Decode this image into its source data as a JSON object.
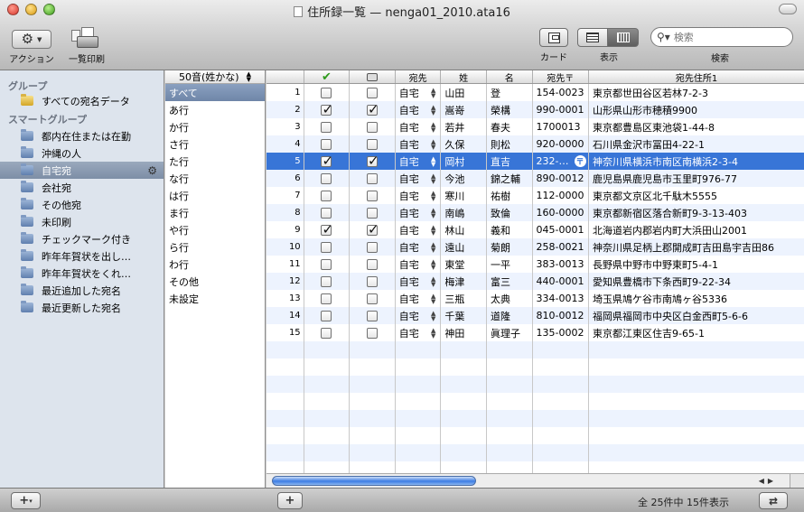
{
  "window": {
    "title": "住所録一覧 — nenga01_2010.ata16"
  },
  "toolbar": {
    "action_label": "アクション",
    "print_label": "一覧印刷",
    "card_label": "カード",
    "view_label": "表示",
    "search_label": "検索",
    "search_placeholder": "検索"
  },
  "sidebar": {
    "group_heading": "グループ",
    "all_item": "すべての宛名データ",
    "smart_heading": "スマートグループ",
    "items": [
      {
        "label": "都内在住または在勤"
      },
      {
        "label": "沖縄の人"
      },
      {
        "label": "自宅宛"
      },
      {
        "label": "会社宛"
      },
      {
        "label": "その他宛"
      },
      {
        "label": "未印刷"
      },
      {
        "label": "チェックマーク付き"
      },
      {
        "label": "昨年年賀状を出し…"
      },
      {
        "label": "昨年年賀状をくれ…"
      },
      {
        "label": "最近追加した宛名"
      },
      {
        "label": "最近更新した宛名"
      }
    ],
    "selected_index": 2
  },
  "index": {
    "sort_label": "50音(姓かな)",
    "items": [
      "すべて",
      "あ行",
      "か行",
      "さ行",
      "た行",
      "な行",
      "は行",
      "ま行",
      "や行",
      "ら行",
      "わ行",
      "その他",
      "未設定"
    ],
    "selected_index": 0
  },
  "table": {
    "headers": {
      "num": "",
      "check": "✔",
      "print": "",
      "dest": "宛先",
      "sei": "姓",
      "mei": "名",
      "zip": "宛先〒",
      "address": "宛先住所1"
    },
    "rows": [
      {
        "no": "1",
        "checked": false,
        "printed": false,
        "dest": "自宅",
        "sei": "山田",
        "mei": "登",
        "zip": "154-0023",
        "address": "東京都世田谷区若林7-2-3"
      },
      {
        "no": "2",
        "checked": true,
        "printed": true,
        "dest": "自宅",
        "sei": "嵩嵜",
        "mei": "榮構",
        "zip": "990-0001",
        "address": "山形県山形市穂積9900"
      },
      {
        "no": "3",
        "checked": false,
        "printed": false,
        "dest": "自宅",
        "sei": "若井",
        "mei": "春夫",
        "zip": "1700013",
        "address": "東京都豊島区東池袋1-44-8"
      },
      {
        "no": "4",
        "checked": false,
        "printed": false,
        "dest": "自宅",
        "sei": "久保",
        "mei": "則松",
        "zip": "920-0000",
        "address": "石川県金沢市冨田4-22-1"
      },
      {
        "no": "5",
        "checked": true,
        "printed": true,
        "dest": "自宅",
        "sei": "岡村",
        "mei": "直吉",
        "zip": "232-…",
        "address": "神奈川県横浜市南区南横浜2-3-4"
      },
      {
        "no": "6",
        "checked": false,
        "printed": false,
        "dest": "自宅",
        "sei": "今池",
        "mei": "錦之輔",
        "zip": "890-0012",
        "address": "鹿児島県鹿児島市玉里町976-77"
      },
      {
        "no": "7",
        "checked": false,
        "printed": false,
        "dest": "自宅",
        "sei": "寒川",
        "mei": "祐樹",
        "zip": "112-0000",
        "address": "東京都文京区北千駄木5555"
      },
      {
        "no": "8",
        "checked": false,
        "printed": false,
        "dest": "自宅",
        "sei": "南嶋",
        "mei": "致倫",
        "zip": "160-0000",
        "address": "東京都新宿区落合新町9-3-13-403"
      },
      {
        "no": "9",
        "checked": true,
        "printed": true,
        "dest": "自宅",
        "sei": "林山",
        "mei": "義和",
        "zip": "045-0001",
        "address": "北海道岩内郡岩内町大浜田山2001"
      },
      {
        "no": "10",
        "checked": false,
        "printed": false,
        "dest": "自宅",
        "sei": "遠山",
        "mei": "菊朗",
        "zip": "258-0021",
        "address": "神奈川県足柄上郡開成町吉田島宇吉田86"
      },
      {
        "no": "11",
        "checked": false,
        "printed": false,
        "dest": "自宅",
        "sei": "東堂",
        "mei": "一平",
        "zip": "383-0013",
        "address": "長野県中野市中野東町5-4-1"
      },
      {
        "no": "12",
        "checked": false,
        "printed": false,
        "dest": "自宅",
        "sei": "梅津",
        "mei": "富三",
        "zip": "440-0001",
        "address": "愛知県豊橋市下条西町9-22-34"
      },
      {
        "no": "13",
        "checked": false,
        "printed": false,
        "dest": "自宅",
        "sei": "三瓶",
        "mei": "太典",
        "zip": "334-0013",
        "address": "埼玉県鳩ケ谷市南鳩ヶ谷5336"
      },
      {
        "no": "14",
        "checked": false,
        "printed": false,
        "dest": "自宅",
        "sei": "千葉",
        "mei": "道隆",
        "zip": "810-0012",
        "address": "福岡県福岡市中央区白金西町5-6-6"
      },
      {
        "no": "15",
        "checked": false,
        "printed": false,
        "dest": "自宅",
        "sei": "神田",
        "mei": "眞理子",
        "zip": "135-0002",
        "address": "東京都江東区住吉9-65-1"
      }
    ],
    "selected_row": 4,
    "empty_rows": 8
  },
  "status": {
    "text": "全 25件中 15件表示"
  },
  "colors": {
    "selection": "#3875d7",
    "sidebar_bg": "#dde4ed",
    "alt_row": "#edf3fe",
    "check_green": "#2e9a1c"
  }
}
